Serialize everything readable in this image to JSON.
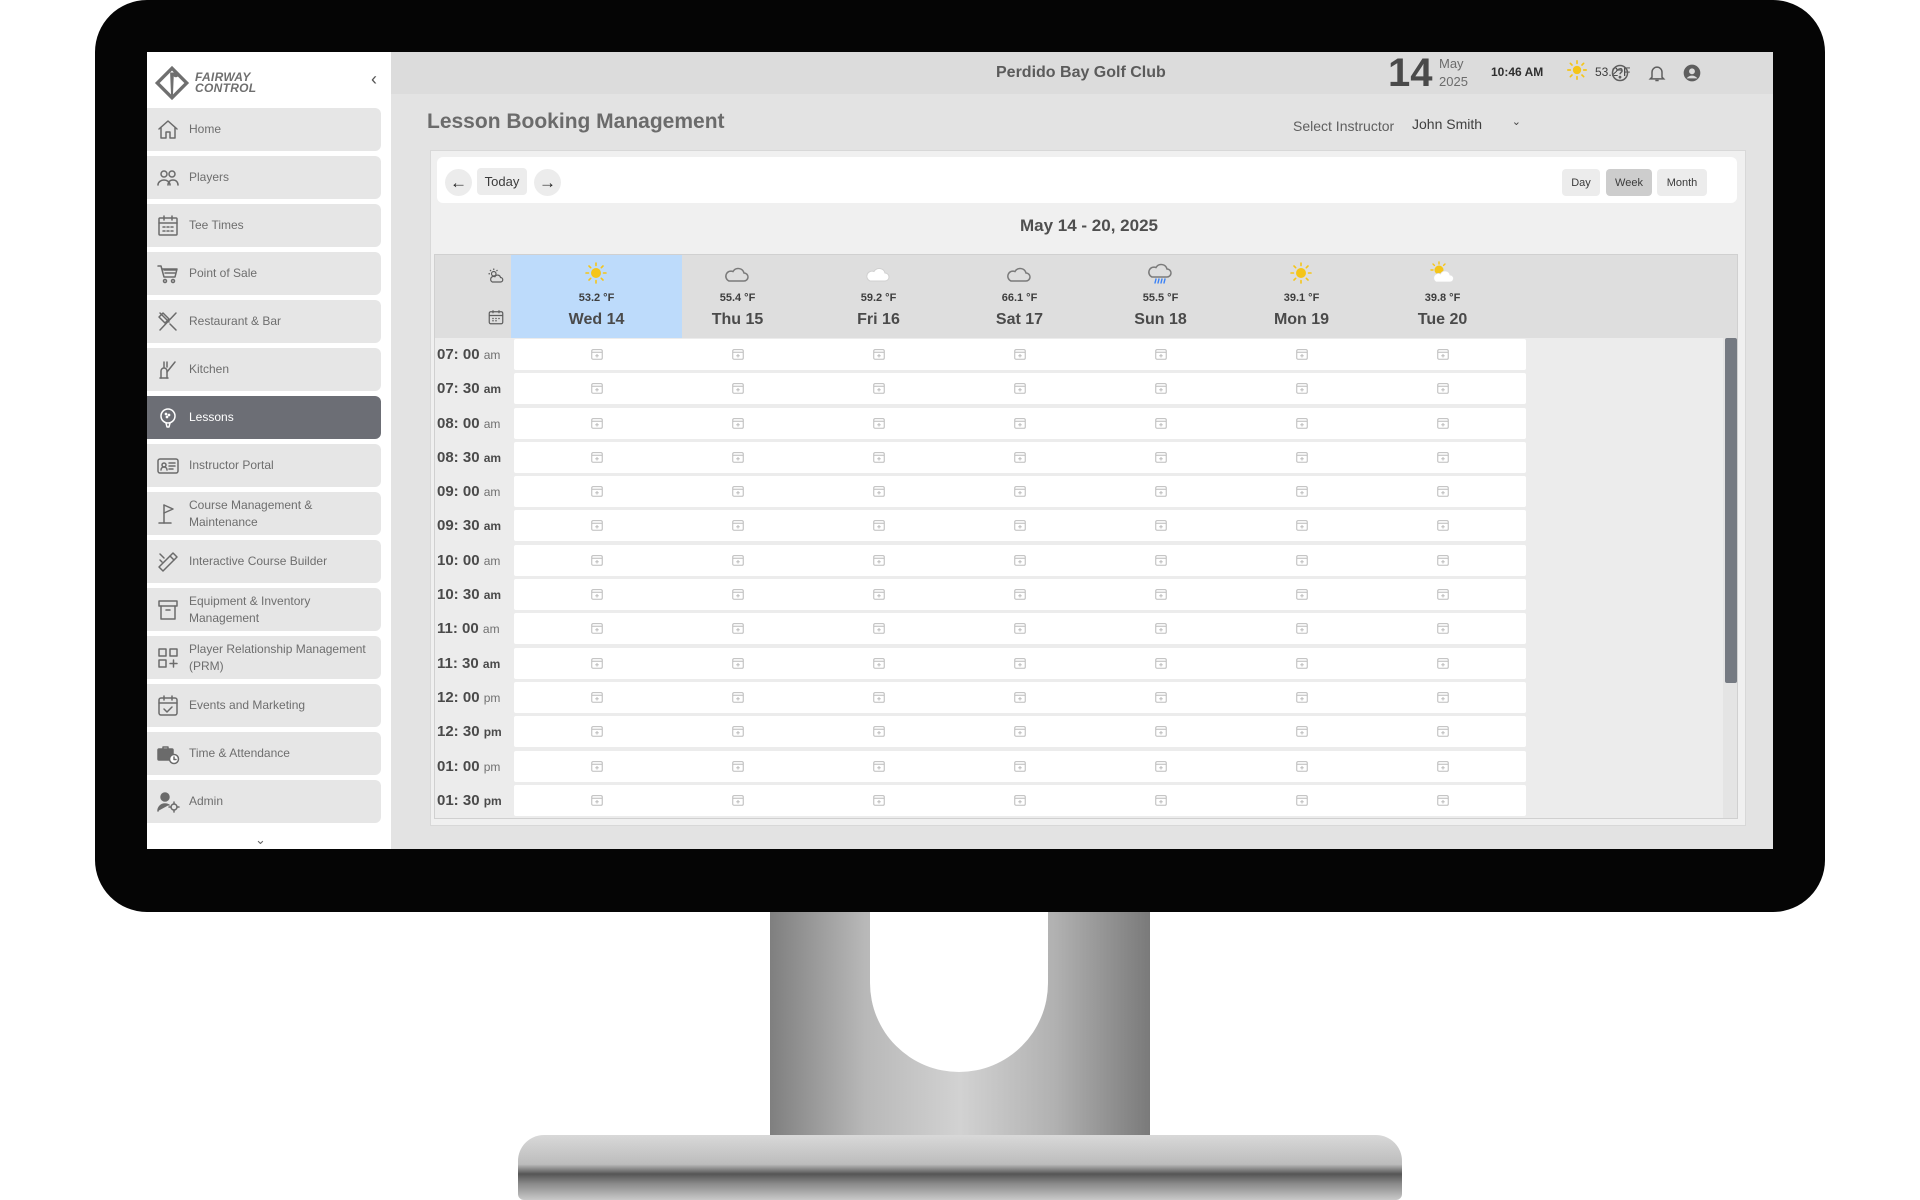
{
  "app": {
    "logo_text_1": "FAIRWAY",
    "logo_text_2": "CONTROL",
    "club_name": "Perdido Bay Golf Club"
  },
  "header": {
    "day": "14",
    "month": "May",
    "year": "2025",
    "time": "10:46  AM",
    "temperature": "53.2°F"
  },
  "sidebar": {
    "items": [
      {
        "label": "Home",
        "icon": "home-icon"
      },
      {
        "label": "Players",
        "icon": "players-icon"
      },
      {
        "label": "Tee Times",
        "icon": "calendar-grid-icon"
      },
      {
        "label": "Point of Sale",
        "icon": "cart-icon"
      },
      {
        "label": "Restaurant & Bar",
        "icon": "utensils-icon"
      },
      {
        "label": "Kitchen",
        "icon": "kitchen-icon"
      },
      {
        "label": "Lessons",
        "icon": "golf-ball-tee-icon",
        "active": true
      },
      {
        "label": "Instructor Portal",
        "icon": "id-card-icon"
      },
      {
        "label": "Course Management & Maintenance",
        "icon": "flag-icon"
      },
      {
        "label": "Interactive Course Builder",
        "icon": "pencil-ruler-icon"
      },
      {
        "label": "Equipment & Inventory Management",
        "icon": "archive-icon"
      },
      {
        "label": "Player Relationship Management (PRM)",
        "icon": "grid-plus-icon"
      },
      {
        "label": "Events and Marketing",
        "icon": "calendar-check-icon"
      },
      {
        "label": "Time & Attendance",
        "icon": "briefcase-clock-icon"
      },
      {
        "label": "Admin",
        "icon": "user-gear-icon"
      }
    ]
  },
  "page": {
    "title": "Lesson Booking Management",
    "instructor_label": "Select Instructor",
    "instructor_value": "John Smith"
  },
  "toolbar": {
    "today": "Today",
    "views": [
      "Day",
      "Week",
      "Month"
    ],
    "active_view": "Week"
  },
  "calendar": {
    "range_title": "May 14 - 20, 2025",
    "days": [
      {
        "name": "Wed",
        "num": "14",
        "temp": "53.2 °F",
        "weather": "sunny",
        "today": true
      },
      {
        "name": "Thu",
        "num": "15",
        "temp": "55.4 °F",
        "weather": "cloudy"
      },
      {
        "name": "Fri",
        "num": "16",
        "temp": "59.2 °F",
        "weather": "cloudy-light"
      },
      {
        "name": "Sat",
        "num": "17",
        "temp": "66.1 °F",
        "weather": "cloudy"
      },
      {
        "name": "Sun",
        "num": "18",
        "temp": "55.5 °F",
        "weather": "rain"
      },
      {
        "name": "Mon",
        "num": "19",
        "temp": "39.1 °F",
        "weather": "sunny"
      },
      {
        "name": "Tue",
        "num": "20",
        "temp": "39.8 °F",
        "weather": "partly-sunny"
      }
    ],
    "times": [
      {
        "t": "07: 00",
        "ap": "am",
        "bold": false
      },
      {
        "t": "07: 30",
        "ap": "am",
        "bold": true
      },
      {
        "t": "08: 00",
        "ap": "am",
        "bold": false
      },
      {
        "t": "08: 30",
        "ap": "am",
        "bold": true
      },
      {
        "t": "09: 00",
        "ap": "am",
        "bold": false
      },
      {
        "t": "09: 30",
        "ap": "am",
        "bold": true
      },
      {
        "t": "10: 00",
        "ap": "am",
        "bold": false
      },
      {
        "t": "10: 30",
        "ap": "am",
        "bold": true
      },
      {
        "t": "11: 00",
        "ap": "am",
        "bold": false
      },
      {
        "t": "11: 30",
        "ap": "am",
        "bold": true
      },
      {
        "t": "12: 00",
        "ap": "pm",
        "bold": false
      },
      {
        "t": "12: 30",
        "ap": "pm",
        "bold": true
      },
      {
        "t": "01: 00",
        "ap": "pm",
        "bold": false
      },
      {
        "t": "01: 30",
        "ap": "pm",
        "bold": true
      }
    ]
  },
  "colors": {
    "today_column": "#bddbfb",
    "active_nav": "#6c6e75",
    "sun": "#f5c518",
    "rain": "#3b82f6"
  }
}
